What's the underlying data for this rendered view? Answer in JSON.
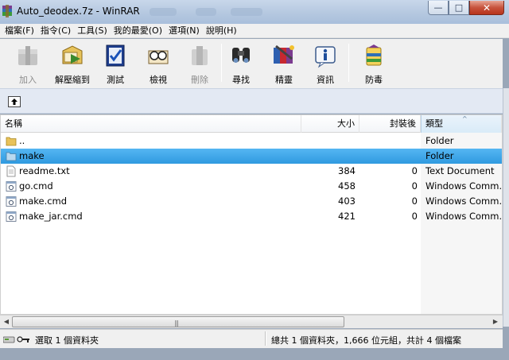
{
  "window": {
    "title": "Auto_deodex.7z - WinRAR",
    "min_glyph": "—",
    "max_glyph": "□",
    "close_glyph": "✕"
  },
  "menu": [
    "檔案(F)",
    "指令(C)",
    "工具(S)",
    "我的最愛(O)",
    "選項(N)",
    "說明(H)"
  ],
  "toolbar": [
    {
      "label": "加入",
      "icon": "add-archive-icon",
      "enabled": false
    },
    {
      "label": "解壓縮到",
      "icon": "extract-to-icon",
      "enabled": true
    },
    {
      "label": "測試",
      "icon": "test-icon",
      "enabled": true
    },
    {
      "label": "檢視",
      "icon": "view-icon",
      "enabled": true
    },
    {
      "label": "刪除",
      "icon": "delete-icon",
      "enabled": false
    },
    {
      "label": "尋找",
      "icon": "find-icon",
      "enabled": true
    },
    {
      "label": "精靈",
      "icon": "wizard-icon",
      "enabled": true
    },
    {
      "label": "資訊",
      "icon": "info-icon",
      "enabled": true
    },
    {
      "label": "防毒",
      "icon": "virus-scan-icon",
      "enabled": true
    }
  ],
  "columns": {
    "name": "名稱",
    "size": "大小",
    "packed": "封裝後",
    "type": "類型"
  },
  "files": [
    {
      "name": "..",
      "size": "",
      "packed": "",
      "type": "Folder",
      "icon": "parent-folder-icon"
    },
    {
      "name": "make",
      "size": "",
      "packed": "",
      "type": "Folder",
      "icon": "folder-icon",
      "selected": true
    },
    {
      "name": "readme.txt",
      "size": "384",
      "packed": "0",
      "type": "Text Document",
      "icon": "text-file-icon"
    },
    {
      "name": "go.cmd",
      "size": "458",
      "packed": "0",
      "type": "Windows Comm...",
      "icon": "cmd-file-icon"
    },
    {
      "name": "make.cmd",
      "size": "403",
      "packed": "0",
      "type": "Windows Comm...",
      "icon": "cmd-file-icon"
    },
    {
      "name": "make_jar.cmd",
      "size": "421",
      "packed": "0",
      "type": "Windows Comm...",
      "icon": "cmd-file-icon"
    }
  ],
  "status": {
    "left": "選取 1 個資料夾",
    "right": "總共 1 個資料夾，1,666 位元組，共計 4 個檔案"
  },
  "colors": {
    "selection": "#33a2e8",
    "titlebar": "#b5c8e0",
    "pathbar": "#e3e9f3"
  }
}
